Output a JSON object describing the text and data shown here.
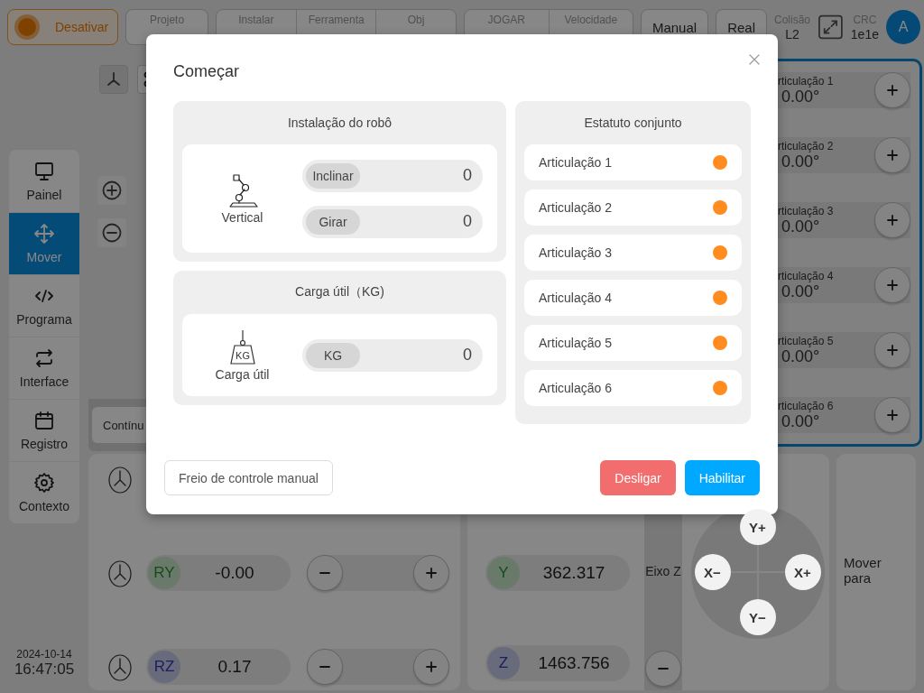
{
  "top_bar": {
    "power_button": {
      "label": "Desativar"
    },
    "status_groups": [
      {
        "cells": [
          {
            "label": "Projeto"
          }
        ]
      },
      {
        "cells": [
          {
            "label": "Instalar"
          },
          {
            "label": "Ferramenta"
          },
          {
            "label": "Obj"
          }
        ]
      },
      {
        "cells": [
          {
            "label": "JOGAR"
          },
          {
            "label": "Velocidade"
          }
        ]
      }
    ],
    "mode_buttons": [
      "Manual",
      "Real"
    ],
    "collision": {
      "label": "Colisão",
      "value": "L2"
    },
    "crc": {
      "label": "CRC",
      "value": "1e1e"
    },
    "avatar": "A"
  },
  "sidebar": {
    "items": [
      {
        "label": "Painel",
        "selected": false
      },
      {
        "label": "Mover",
        "selected": true
      },
      {
        "label": "Programa",
        "selected": false
      },
      {
        "label": "Interface",
        "selected": false
      },
      {
        "label": "Registro",
        "selected": false
      },
      {
        "label": "Contexto",
        "selected": false
      }
    ],
    "date": "2024-10-14",
    "time": "16:47:05"
  },
  "motion_mode": {
    "value": "Contínu"
  },
  "joint_panel": {
    "joints": [
      {
        "name": "rticulação 1",
        "value": "0.00°"
      },
      {
        "name": "rticulação 2",
        "value": "0.00°"
      },
      {
        "name": "rticulação 3",
        "value": "0.00°"
      },
      {
        "name": "rticulação 4",
        "value": "0.00°"
      },
      {
        "name": "rticulação 5",
        "value": "0.00°"
      },
      {
        "name": "rticulação 6",
        "value": "0.00°"
      }
    ]
  },
  "rotation_controls": [
    {
      "axis": "RY",
      "value": "-0.00"
    },
    {
      "axis": "RZ",
      "value": "0.17"
    }
  ],
  "position_controls": [
    {
      "axis": "Y",
      "value": "362.317"
    },
    {
      "axis": "Z",
      "value": "1463.756"
    }
  ],
  "z_axis": {
    "label": "Eixo Z"
  },
  "jog_pad": {
    "buttons": [
      "Y+",
      "X−",
      "X+",
      "Y−"
    ]
  },
  "move_to": {
    "label": "Mover para"
  },
  "dialog": {
    "title": "Começar",
    "installation": {
      "title": "Instalação do robô",
      "caption": "Vertical",
      "fields": [
        {
          "label": "Inclinar",
          "value": "0"
        },
        {
          "label": "Girar",
          "value": "0"
        }
      ]
    },
    "payload": {
      "title": "Carga útil（KG)",
      "icon_label": "KG",
      "caption": "Carga útil",
      "fields": [
        {
          "label": "KG",
          "value": "0"
        }
      ]
    },
    "joint_status": {
      "title": "Estatuto conjunto",
      "joints": [
        {
          "name": "Articulação 1",
          "color": "#ff8c1f"
        },
        {
          "name": "Articulação 2",
          "color": "#ff8c1f"
        },
        {
          "name": "Articulação 3",
          "color": "#ff8c1f"
        },
        {
          "name": "Articulação 4",
          "color": "#ff8c1f"
        },
        {
          "name": "Articulação 5",
          "color": "#ff8c1f"
        },
        {
          "name": "Articulação 6",
          "color": "#ff8c1f"
        }
      ]
    },
    "buttons": [
      {
        "label": "Freio de controle manual",
        "kind": "outline"
      },
      {
        "label": "Desligar",
        "kind": "danger"
      },
      {
        "label": "Habilitar",
        "kind": "primary"
      }
    ]
  }
}
